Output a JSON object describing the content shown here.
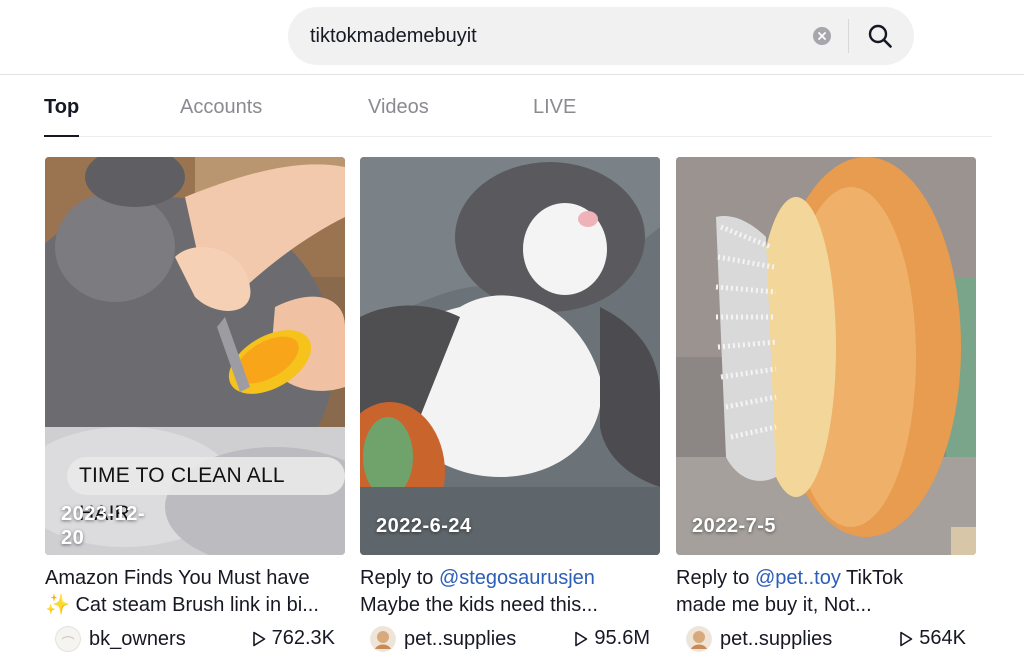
{
  "search": {
    "query": "tiktokmademebuyit"
  },
  "icons": {
    "clear": "clear-icon",
    "search": "search-icon",
    "play": "play-icon"
  },
  "tabs": [
    {
      "label": "Top",
      "active": true
    },
    {
      "label": "Accounts",
      "active": false
    },
    {
      "label": "Videos",
      "active": false
    },
    {
      "label": "LIVE",
      "active": false
    }
  ],
  "videos": [
    {
      "caption_overlay": "TIME TO CLEAN ALL HAIR",
      "date_line1": "2023-12-",
      "date_line2": "20",
      "desc_line1": "Amazon Finds You Must have",
      "desc_line2_icon": "✨",
      "desc_line2": " Cat steam Brush link in bi...",
      "author": "bk_owners",
      "views": "762.3K"
    },
    {
      "date_line1": "2022-6-24",
      "desc_prefix": "Reply to ",
      "desc_mention": "@stegosaurusjen",
      "desc_line2": "Maybe the kids need this...",
      "author": "pet..supplies",
      "views": "95.6M"
    },
    {
      "date_line1": "2022-7-5",
      "desc_prefix": "Reply to ",
      "desc_mention": "@pet..toy",
      "desc_suffix": " TikTok",
      "desc_line2": "made me buy it, Not...",
      "author": "pet..supplies",
      "views": "564K"
    }
  ],
  "colors": {
    "accent_link": "#2b5db9",
    "tab_inactive": "#8a8b91",
    "text": "#161823"
  }
}
